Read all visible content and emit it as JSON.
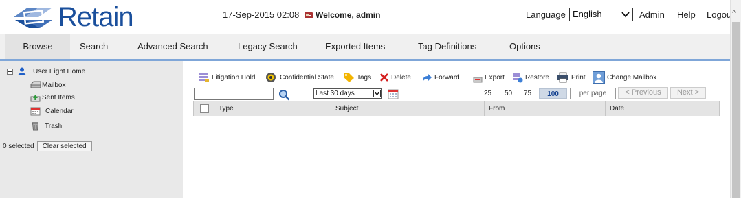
{
  "app": {
    "name": "Retain",
    "datetime": "17-Sep-2015 02:08",
    "welcome": "Welcome, admin"
  },
  "header": {
    "language_label": "Language",
    "language_value": "English",
    "admin": "Admin",
    "help": "Help",
    "logout": "Logou"
  },
  "tabs": [
    {
      "label": "Browse",
      "active": true
    },
    {
      "label": "Search"
    },
    {
      "label": "Advanced Search"
    },
    {
      "label": "Legacy Search"
    },
    {
      "label": "Exported Items"
    },
    {
      "label": "Tag Definitions"
    },
    {
      "label": "Options"
    }
  ],
  "sidebar": {
    "root": "User Eight Home",
    "items": [
      {
        "label": "Mailbox",
        "icon": "mailbox-icon"
      },
      {
        "label": "Sent Items",
        "icon": "sent-items-icon"
      },
      {
        "label": "Calendar",
        "icon": "calendar-icon"
      },
      {
        "label": "Trash",
        "icon": "trash-icon"
      }
    ],
    "selected_count": "0 selected",
    "clear_label": "Clear selected"
  },
  "toolbar": {
    "litigation_hold": "Litigation Hold",
    "confidential_state": "Confidential State",
    "tags": "Tags",
    "delete": "Delete",
    "forward": "Forward",
    "export": "Export",
    "restore": "Restore",
    "print": "Print",
    "change_mailbox": "Change Mailbox"
  },
  "filter": {
    "date_range": "Last 30 days",
    "page_sizes": [
      "25",
      "50",
      "75",
      "100"
    ],
    "active_page_size": "100",
    "per_page_placeholder": "per page",
    "previous": "< Previous",
    "next": "Next >"
  },
  "grid": {
    "columns": [
      "Type",
      "Subject",
      "From",
      "Date"
    ]
  },
  "colors": {
    "brand": "#1a4f9c",
    "tab_underline": "#7fa6d8"
  }
}
